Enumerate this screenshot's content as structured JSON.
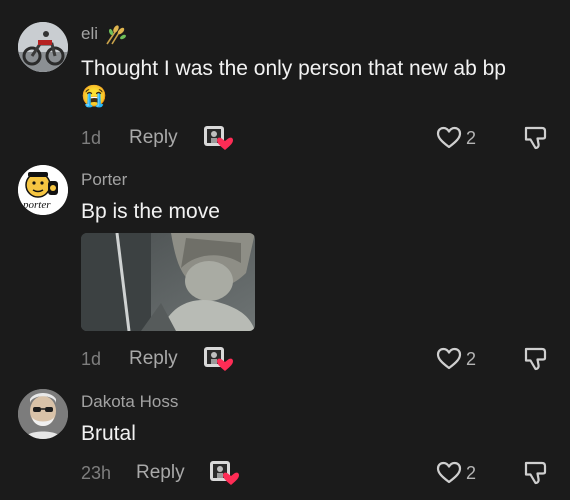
{
  "comments": [
    {
      "username": "eli",
      "text": "Thought I was the only person that new ab bp",
      "emoji": "😭",
      "time": "1d",
      "reply_label": "Reply",
      "likes": "2"
    },
    {
      "username": "Porter",
      "text": "Bp is the move",
      "avatar_caption": "porter",
      "time": "1d",
      "reply_label": "Reply",
      "likes": "2"
    },
    {
      "username": "Dakota Hoss",
      "text": "Brutal",
      "time": "23h",
      "reply_label": "Reply",
      "likes": "2"
    }
  ],
  "colors": {
    "background": "#1b1b1b",
    "creator_heart": "#fe2c55"
  },
  "icons": [
    "wheat-icon",
    "heart-outline-icon",
    "dislike-icon",
    "creator-liked-icon"
  ]
}
